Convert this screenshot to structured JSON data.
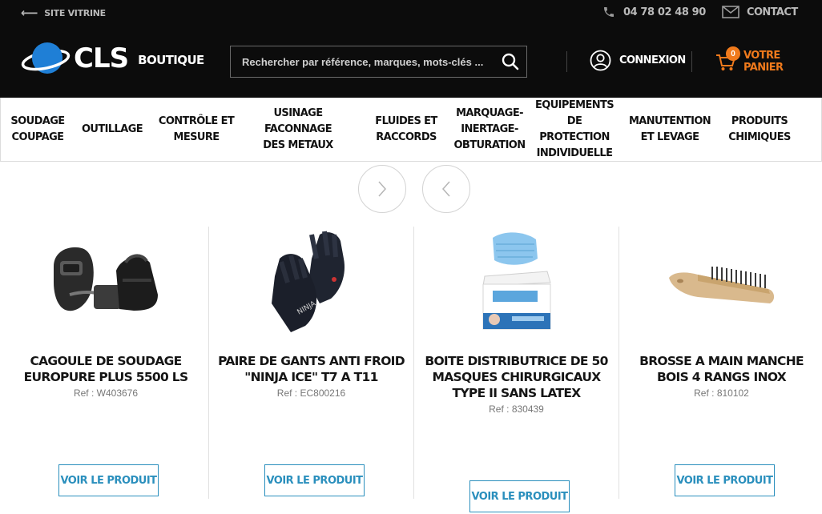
{
  "topbar": {
    "back_label": "SITE VITRINE",
    "phone": "04 78 02 48 90",
    "contact_label": "CONTACT"
  },
  "brand": {
    "logo_text": "CLS",
    "sub_label": "BOUTIQUE"
  },
  "search": {
    "placeholder": "Rechercher par référence, marques, mots-clés ...",
    "value": ""
  },
  "account": {
    "login_label": "CONNEXION"
  },
  "cart": {
    "count": "0",
    "label": "VOTRE PANIER"
  },
  "nav": {
    "items": [
      {
        "label": "SOUDAGE\nCOUPAGE"
      },
      {
        "label": "OUTILLAGE"
      },
      {
        "label": "CONTRÔLE ET\nMESURE"
      },
      {
        "label": "USINAGE FACONNAGE\nDES METAUX"
      },
      {
        "label": "FLUIDES ET\nRACCORDS"
      },
      {
        "label": "MARQUAGE-\nINERTAGE-\nOBTURATION"
      },
      {
        "label": "EQUIPEMENTS DE\nPROTECTION\nINDIVIDUELLE"
      },
      {
        "label": "MANUTENTION\nET LEVAGE"
      },
      {
        "label": "PRODUITS CHIMIQUES"
      }
    ]
  },
  "products": [
    {
      "name": "CAGOULE DE SOUDAGE EUROPURE PLUS 5500 LS",
      "ref": "Ref : W403676",
      "button": "VOIR LE PRODUIT"
    },
    {
      "name": "PAIRE DE GANTS ANTI FROID \"NINJA ICE\" T7 A T11",
      "ref": "Ref : EC800216",
      "button": "VOIR LE PRODUIT"
    },
    {
      "name": "BOITE DISTRIBUTRICE DE 50 MASQUES CHIRURGICAUX TYPE II SANS LATEX",
      "ref": "Ref : 830439",
      "button": "VOIR LE PRODUIT"
    },
    {
      "name": "BROSSE A MAIN MANCHE BOIS 4 RANGS INOX",
      "ref": "Ref : 810102",
      "button": "VOIR LE PRODUIT"
    }
  ],
  "colors": {
    "header_bg": "#0c0c0c",
    "accent_orange": "#f07a1c",
    "button_blue": "#2a8fbd",
    "logo_blue": "#1f7fd6"
  },
  "icons": {
    "back": "arrow-left-icon",
    "phone": "phone-icon",
    "contact": "envelope-icon",
    "search": "search-icon",
    "login": "user-icon",
    "cart": "cart-icon",
    "next": "chevron-right-icon",
    "prev": "chevron-left-icon"
  }
}
